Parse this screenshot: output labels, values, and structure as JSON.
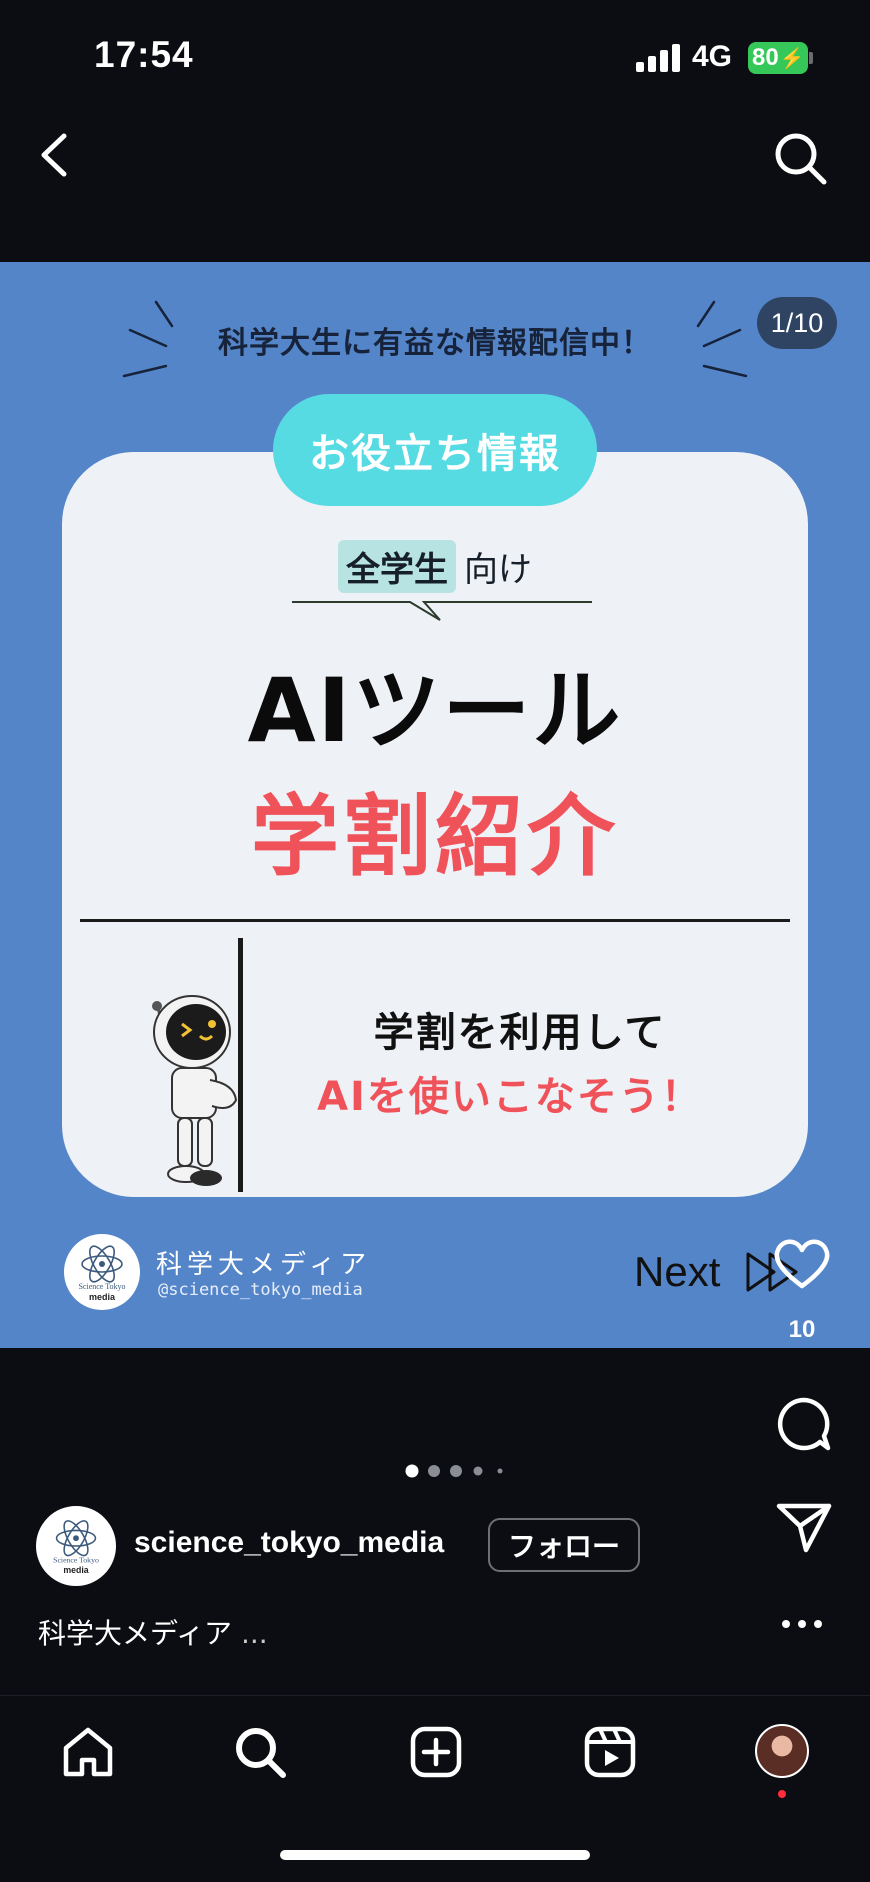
{
  "status_bar": {
    "time": "17:54",
    "network": "4G",
    "battery": "80"
  },
  "post": {
    "counter": "1/10",
    "banner": "科学大生に有益な情報配信中！",
    "pill_label": "お役立ち情報",
    "target_highlight": "全学生",
    "target_suffix": "向け",
    "title_line1": "AIツール",
    "title_line2": "学割紹介",
    "message_line1": "学割を利用して",
    "message_line2": "AIを使いこなそう！",
    "brand_name": "科学大メディア",
    "brand_handle": "@science_tokyo_media",
    "logo_text_top": "Science Tokyo",
    "logo_text_bottom": "media",
    "next_label": "Next"
  },
  "actions": {
    "like_count": "10"
  },
  "author": {
    "username": "science_tokyo_media",
    "follow_label": "フォロー",
    "caption": "科学大メディア",
    "caption_more": "..."
  },
  "carousel": {
    "total_dots": 5,
    "active_index": 0
  },
  "colors": {
    "post_background": "#5485c9",
    "accent_red": "#f0525a",
    "pill_cyan": "#56dbe3",
    "battery_green": "#36c759"
  },
  "icons": {
    "back": "chevron-left-icon",
    "search": "search-icon",
    "like": "heart-icon",
    "comment": "comment-icon",
    "share": "send-icon",
    "more": "more-icon",
    "nav": [
      "home-icon",
      "search-icon",
      "create-icon",
      "reels-icon",
      "profile-avatar"
    ]
  }
}
